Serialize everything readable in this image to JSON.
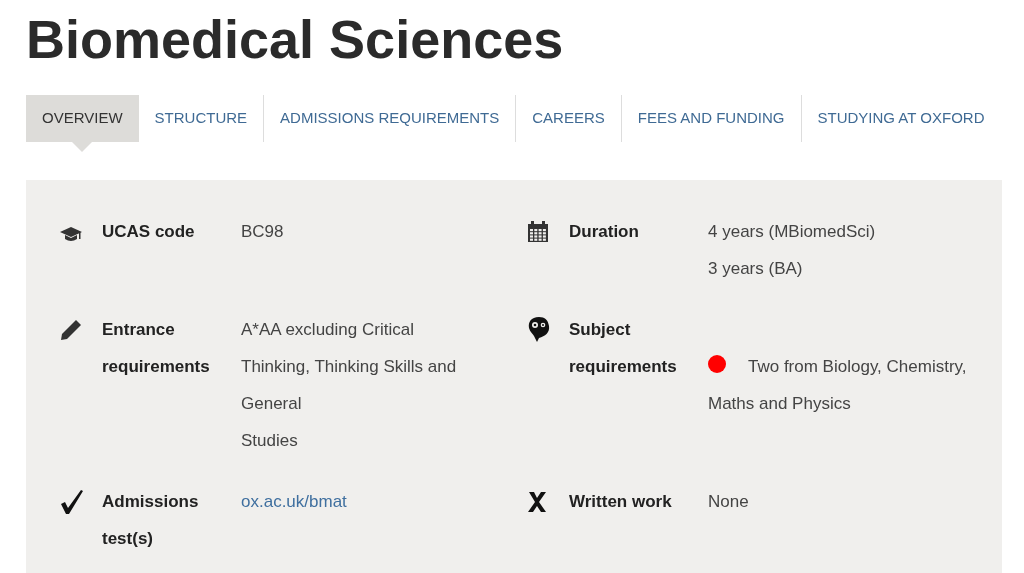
{
  "title": "Biomedical Sciences",
  "tabs": [
    {
      "label": "OVERVIEW",
      "selected": true
    },
    {
      "label": "STRUCTURE",
      "selected": false
    },
    {
      "label": "ADMISSIONS REQUIREMENTS",
      "selected": false
    },
    {
      "label": "CAREERS",
      "selected": false
    },
    {
      "label": "FEES AND FUNDING",
      "selected": false
    },
    {
      "label": "STUDYING AT OXFORD",
      "selected": false
    }
  ],
  "facts": [
    {
      "kind": "cap",
      "label": "UCAS code",
      "lines": [
        "BC98"
      ]
    },
    {
      "kind": "calendar",
      "label": "Duration",
      "lines": [
        "4 years (MBiomedSci)",
        "3 years (BA)"
      ]
    },
    {
      "kind": "pencil",
      "label": "Entrance requirements",
      "lines": [
        "A*AA excluding Critical",
        "Thinking, Thinking Skills and",
        "General",
        "Studies"
      ]
    },
    {
      "kind": "head",
      "label": "Subject requirements",
      "color": "#ff0000",
      "text": "Two from Biology, Chemistry, Maths and Physics"
    },
    {
      "kind": "check",
      "label": "Admissions test(s)",
      "link": "ox.ac.uk/bmat"
    },
    {
      "kind": "cross",
      "label": "Written work",
      "lines": [
        "None"
      ]
    }
  ]
}
